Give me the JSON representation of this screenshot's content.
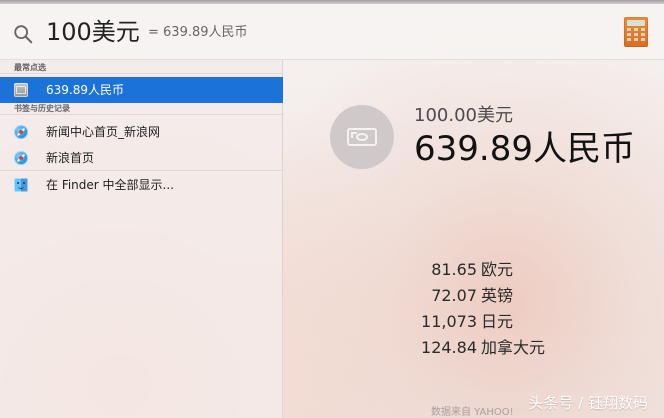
{
  "search": {
    "query": "100美元",
    "inline_result": "= 639.89人民币"
  },
  "sidebar": {
    "sections": {
      "top_hits": "最常点选",
      "history": "书签与历史记录"
    },
    "items": [
      {
        "label": "639.89人民币",
        "icon": "money-stack-icon",
        "selected": true
      },
      {
        "label": "新闻中心首页_新浪网",
        "icon": "compass-icon",
        "selected": false
      },
      {
        "label": "新浪首页",
        "icon": "compass-icon",
        "selected": false
      },
      {
        "label": "在 Finder 中全部显示...",
        "icon": "finder-icon",
        "selected": false
      }
    ]
  },
  "detail": {
    "source_amount": "100.00美元",
    "result_amount": "639.89人民币",
    "rates": [
      {
        "value": "81.65",
        "label": "欧元"
      },
      {
        "value": "72.07",
        "label": "英镑"
      },
      {
        "value": "11,073",
        "label": "日元"
      },
      {
        "value": "124.84",
        "label": "加拿大元"
      }
    ],
    "provider": "数据来自 YAHOO!"
  },
  "watermark": {
    "text": "头条号 / 钰翔数码"
  },
  "colors": {
    "accent": "#1b73da",
    "text_primary": "#121212",
    "text_secondary": "#4e4a4d"
  }
}
